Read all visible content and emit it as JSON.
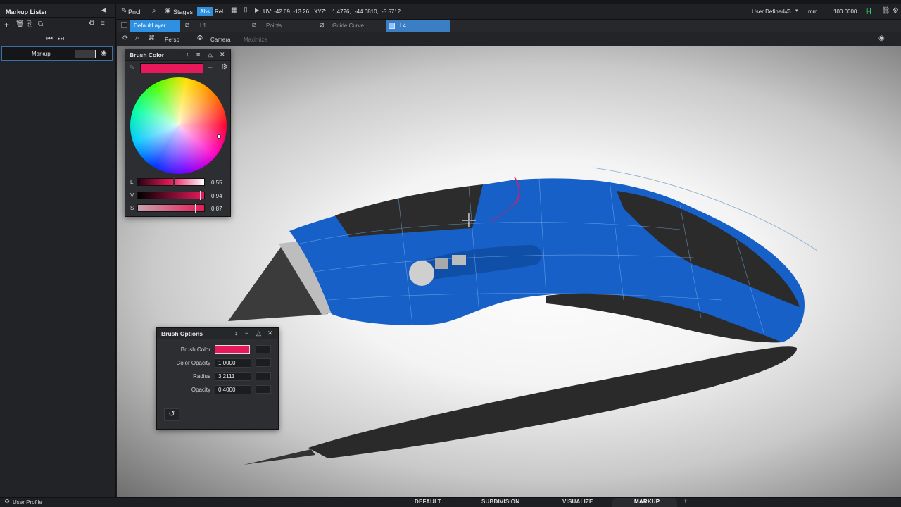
{
  "topbar": {
    "pencil_label": "Pncl",
    "stages_label": "Stages",
    "abs_label": "Abs",
    "rel_label": "Rel",
    "uv_readout": "UV: -42.69, -13.26",
    "xyz_label": "XYZ:",
    "xyz_x": "1.4726,",
    "xyz_y": "-44.6810,",
    "xyz_z": "-5.5712",
    "construction_plane": "User Defined#3",
    "units": "mm",
    "scale": "100.0000",
    "h_label": "H"
  },
  "sidebar": {
    "title": "Markup Lister",
    "item_label": "Markup"
  },
  "layers": {
    "default": "DefaultLayer",
    "l1": "L1",
    "points": "Points",
    "guide_curve": "Guide Curve",
    "l4": "L4"
  },
  "viewbar": {
    "persp": "Persp",
    "camera": "Camera",
    "maximize": "Maximize"
  },
  "brush_color": {
    "title": "Brush Color",
    "swatch": "#e8195a",
    "l_label": "L",
    "l_value": "0.55",
    "v_label": "V",
    "v_value": "0.94",
    "s_label": "S",
    "s_value": "0.87"
  },
  "brush_options": {
    "title": "Brush Options",
    "brush_color_label": "Brush Color",
    "color_opacity_label": "Color Opacity",
    "color_opacity_value": "1.0000",
    "radius_label": "Radius",
    "radius_value": "3.2111",
    "opacity_label": "Opacity",
    "opacity_value": "0.4000"
  },
  "bottom": {
    "user_profile": "User Profile",
    "tabs": [
      "DEFAULT",
      "SUBDIVISION",
      "VISUALIZE",
      "MARKUP"
    ],
    "active_tab": "MARKUP"
  },
  "colors": {
    "accent_blue": "#2f8fe0",
    "brush_pink": "#e8195a",
    "model_blue": "#1660c8"
  }
}
